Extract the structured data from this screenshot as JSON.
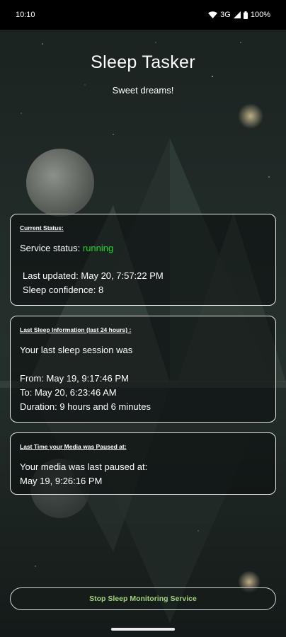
{
  "statusbar": {
    "time": "10:10",
    "network": "3G",
    "battery": "100%"
  },
  "header": {
    "title": "Sleep Tasker",
    "subtitle": "Sweet dreams!"
  },
  "current_status": {
    "heading": "Current Status:",
    "service_label": "Service status: ",
    "service_value": "running",
    "last_updated": "Last updated: May 20, 7:57:22 PM",
    "sleep_confidence": "Sleep confidence: 8"
  },
  "last_sleep": {
    "heading": "Last Sleep Information (last 24 hours) :",
    "intro": "Your last sleep session was",
    "from": "From: May 19, 9:17:46 PM",
    "to": "To: May 20, 6:23:46 AM",
    "duration": "Duration: 9 hours and 6 minutes"
  },
  "media_paused": {
    "heading": "Last Time your Media was Paused at:",
    "intro": "Your media was last paused at:",
    "time": "May 19, 9:26:16 PM"
  },
  "actions": {
    "stop_label": "Stop Sleep Monitoring Service"
  },
  "colors": {
    "running": "#22d62a",
    "button_text": "#a2d27d"
  }
}
